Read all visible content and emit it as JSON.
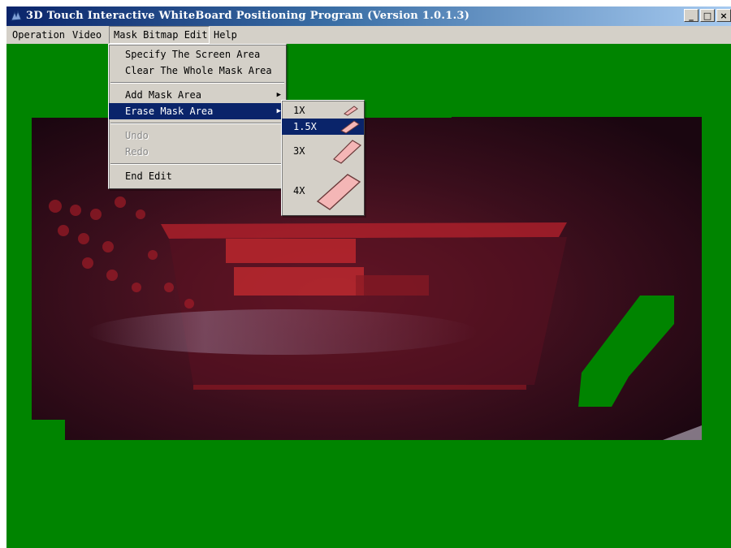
{
  "window": {
    "title": "3D Touch Interactive WhiteBoard Positioning Program (Version 1.0.1.3)",
    "icon": "app-logo-icon",
    "controls": {
      "minimize": "_",
      "maximize": "□",
      "close": "×"
    }
  },
  "menubar": {
    "items": [
      {
        "label": "Operation"
      },
      {
        "label": "Video"
      },
      {
        "label": "Mask Bitmap Edit",
        "open": true
      },
      {
        "label": "Help"
      }
    ]
  },
  "mask_menu": {
    "items": [
      {
        "label": "Specify The Screen Area"
      },
      {
        "label": "Clear The Whole Mask Area"
      },
      {
        "label": "Add Mask Area",
        "submenu": true
      },
      {
        "label": "Erase Mask Area",
        "submenu": true,
        "highlighted": true
      },
      {
        "label": "Undo",
        "disabled": true
      },
      {
        "label": "Redo",
        "disabled": true
      },
      {
        "label": "End Edit"
      }
    ]
  },
  "erase_submenu": {
    "items": [
      {
        "label": "1X",
        "icon": "eraser-small-icon"
      },
      {
        "label": "1.5X",
        "icon": "eraser-medium-icon",
        "highlighted": true
      },
      {
        "label": "3X",
        "icon": "eraser-large-icon"
      },
      {
        "label": "4X",
        "icon": "eraser-xlarge-icon"
      }
    ]
  },
  "colors": {
    "mask_green": "#008400",
    "camera_dark": "#2a0a12",
    "camera_red": "#c0202a",
    "eraser_pink": "#f4b6b6",
    "highlight": "#0a246a"
  }
}
